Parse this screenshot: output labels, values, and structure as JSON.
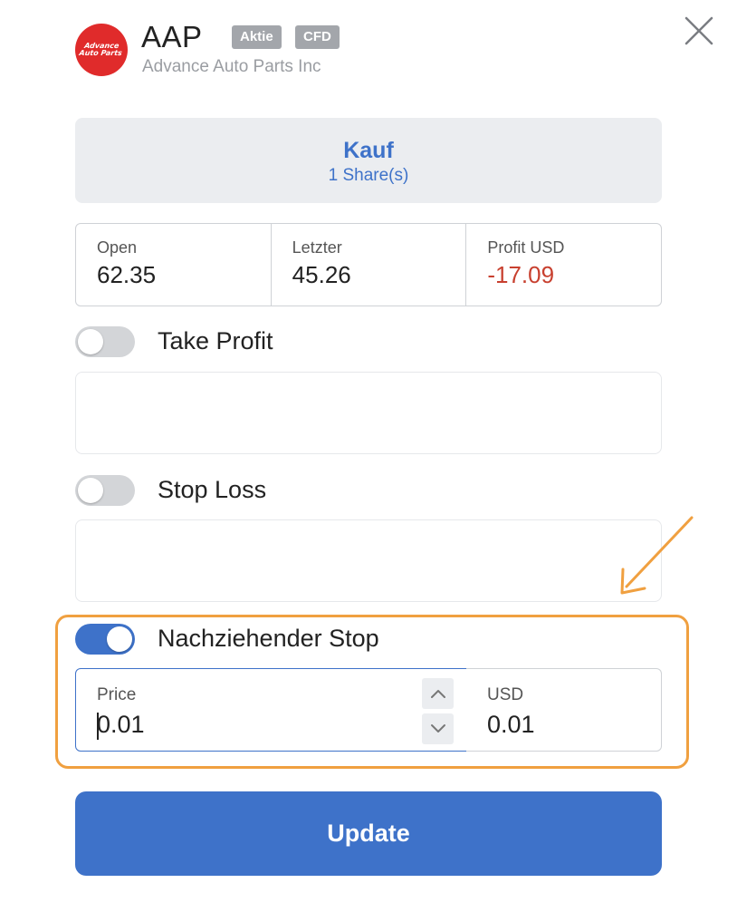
{
  "header": {
    "logo_text_line1": "Advance",
    "logo_text_line2": "Auto Parts",
    "ticker": "AAP",
    "badges": [
      "Aktie",
      "CFD"
    ],
    "company": "Advance Auto Parts Inc",
    "close_icon": "close-icon"
  },
  "direction": {
    "label": "Kauf",
    "quantity": "1 Share(s)",
    "color": "#3e72c9"
  },
  "stats": [
    {
      "label": "Open",
      "value": "62.35"
    },
    {
      "label": "Letzter",
      "value": "45.26"
    },
    {
      "label": "Profit USD",
      "value": "-17.09",
      "color": "#c8402f"
    }
  ],
  "take_profit": {
    "label": "Take Profit",
    "enabled": false
  },
  "stop_loss": {
    "label": "Stop Loss",
    "enabled": false
  },
  "trailing_stop": {
    "label": "Nachziehender Stop",
    "enabled": true,
    "price_label": "Price",
    "price_value": "0.01",
    "usd_label": "USD",
    "usd_value": "0.01",
    "highlight_color": "#f0a040"
  },
  "update_button": {
    "label": "Update"
  }
}
